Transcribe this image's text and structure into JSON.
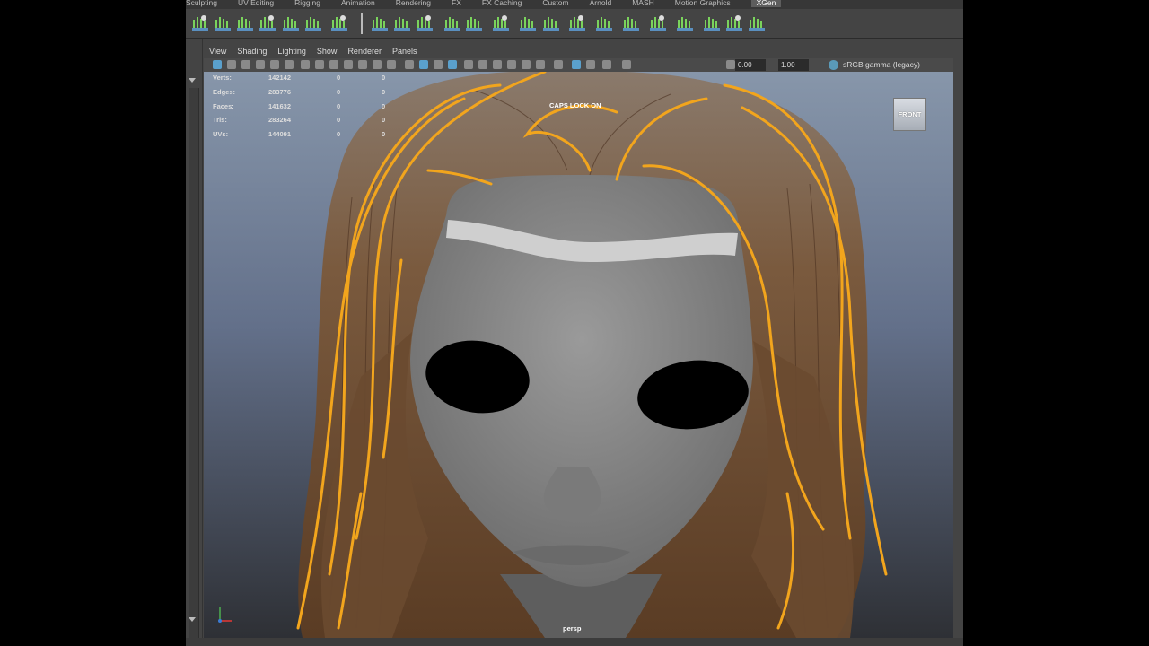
{
  "shelf": {
    "tabs": [
      {
        "label": "Sculpting",
        "active": false
      },
      {
        "label": "UV Editing",
        "active": false
      },
      {
        "label": "Rigging",
        "active": false
      },
      {
        "label": "Animation",
        "active": false
      },
      {
        "label": "Rendering",
        "active": false
      },
      {
        "label": "FX",
        "active": false
      },
      {
        "label": "FX Caching",
        "active": false
      },
      {
        "label": "Custom",
        "active": false
      },
      {
        "label": "Arnold",
        "active": false
      },
      {
        "label": "MASH",
        "active": false
      },
      {
        "label": "Motion Graphics",
        "active": false
      },
      {
        "label": "XGen",
        "active": true
      }
    ],
    "icons": [
      "xgen-lock-icon",
      "xgen-collection-icon",
      "xgen-layers-icon",
      "xgen-groom-icon",
      "xgen-guides-icon",
      "xgen-guides-edit-icon",
      "xgen-delete-guide-icon",
      "xgen-editor-icon",
      "xgen-add-guide-icon",
      "xgen-guide-plus-icon",
      "xgen-sculpt-icon",
      "xgen-comb-icon",
      "xgen-smooth-icon",
      "xgen-length-icon",
      "xgen-cut-icon",
      "xgen-bend-icon",
      "xgen-clump-icon",
      "xgen-noise-icon",
      "xgen-attract-icon",
      "xgen-spray-icon",
      "xgen-scatter-icon",
      "xgen-preview-icon",
      "xgen-render-icon"
    ]
  },
  "panel_menu": [
    "View",
    "Shading",
    "Lighting",
    "Show",
    "Renderer",
    "Panels"
  ],
  "viewport_toolbar": {
    "exposure": "0.00",
    "gamma": "1.00",
    "color_space": "sRGB gamma (legacy)"
  },
  "hud": {
    "rows": [
      {
        "label": "Verts:",
        "total": "142142",
        "selected": "0",
        "third": "0"
      },
      {
        "label": "Edges:",
        "total": "283776",
        "selected": "0",
        "third": "0"
      },
      {
        "label": "Faces:",
        "total": "141632",
        "selected": "0",
        "third": "0"
      },
      {
        "label": "Tris:",
        "total": "283264",
        "selected": "0",
        "third": "0"
      },
      {
        "label": "UVs:",
        "total": "144091",
        "selected": "0",
        "third": "0"
      }
    ],
    "caps_lock": "CAPS LOCK ON",
    "camera_name": "persp",
    "view_cube_label": "FRONT"
  },
  "colors": {
    "viewport_top": "#8795a8",
    "viewport_bottom": "#2e3035",
    "guide_curve": "#f2a51d",
    "hair": "#6a4a30",
    "skin": "#8b8b8b",
    "ui_bg": "#444444",
    "xgen_icon": "#7ad35c"
  }
}
